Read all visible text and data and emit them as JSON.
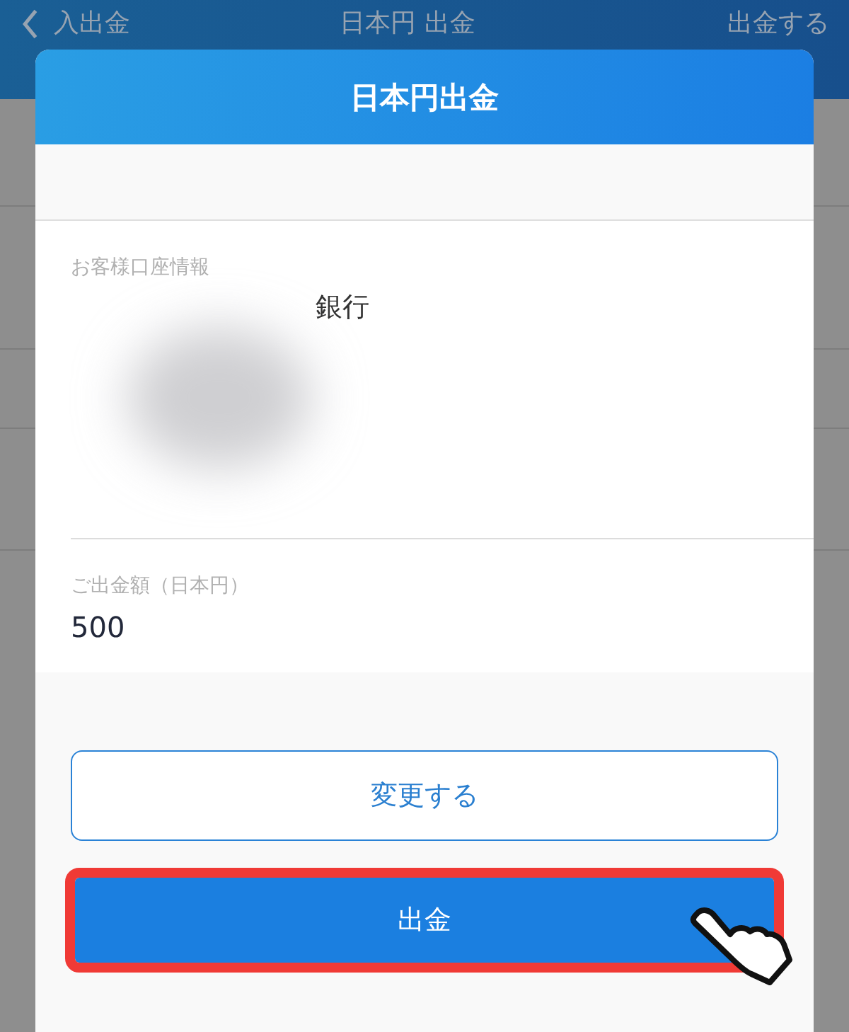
{
  "app_bar": {
    "back_label": "入出金",
    "title": "日本円 出金",
    "action": "出金する"
  },
  "dialog": {
    "title": "日本円出金",
    "account": {
      "label": "お客様口座情報",
      "bank": "銀行"
    },
    "amount": {
      "label": "ご出金額（日本円）",
      "value": "500"
    },
    "buttons": [
      {
        "label": "変更する",
        "kind": "outline",
        "highlighted": false
      },
      {
        "label": "出金",
        "kind": "primary",
        "highlighted": true
      }
    ]
  }
}
